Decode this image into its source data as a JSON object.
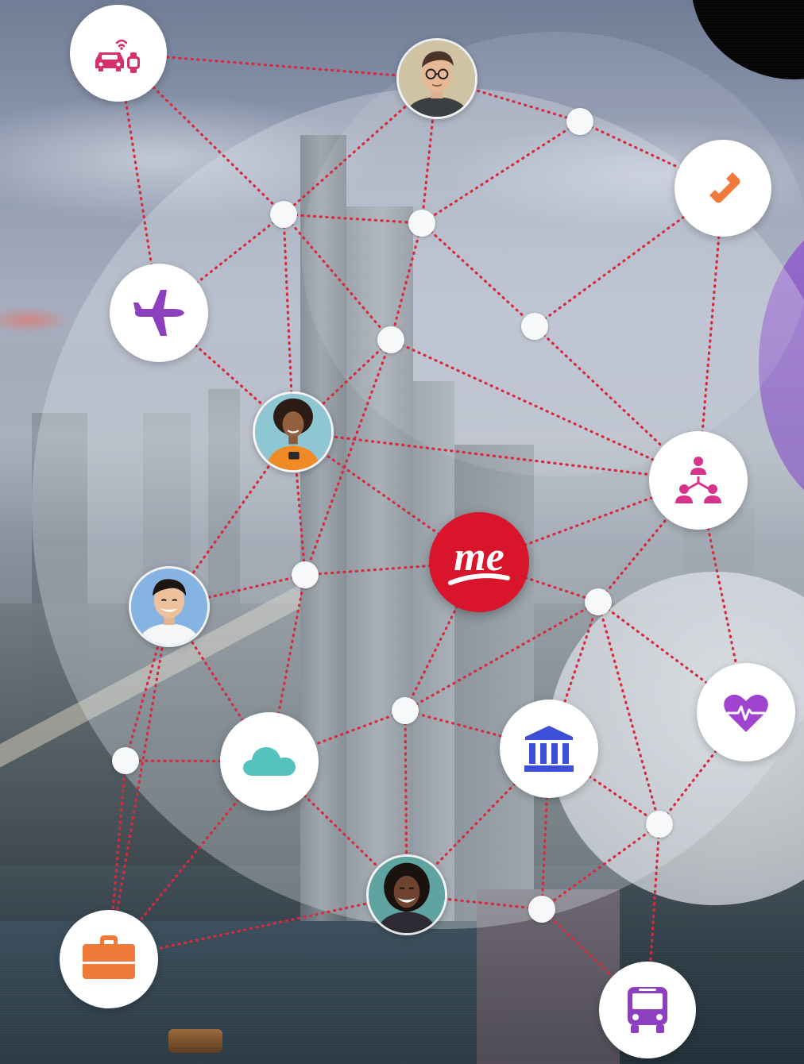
{
  "center_badge": {
    "logo_text": "me"
  },
  "colors": {
    "link_red": "#d9293f",
    "me_red": "#d9152c",
    "car_icon": "#d5306b",
    "phone_icon": "#f07a3a",
    "plane_icon": "#8c3fbf",
    "org_icon": "#d8338a",
    "bank_icon": "#3d4fd8",
    "heart_icon": "#a044d0",
    "cloud_icon": "#56c2bd",
    "briefcase_icon": "#f07a3a",
    "bus_icon": "#8c3fbf",
    "purple_panel": "#7b4bbf"
  },
  "icons": [
    "car-smartwatch-icon",
    "phone-icon",
    "plane-icon",
    "organization-chart-icon",
    "bank-icon",
    "heart-pulse-icon",
    "cloud-icon",
    "briefcase-icon",
    "bus-icon",
    "me-logo"
  ],
  "people": [
    "man-with-glasses-avatar",
    "woman-orange-sweater-avatar",
    "smiling-young-man-avatar",
    "smiling-woman-avatar"
  ]
}
